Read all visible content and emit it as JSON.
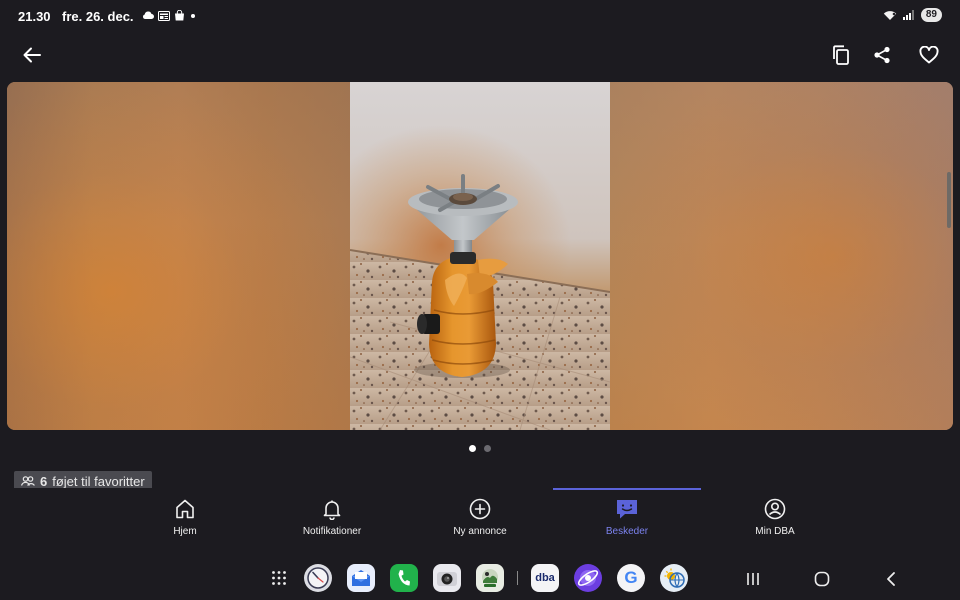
{
  "status_bar": {
    "time": "21.30",
    "date": "fre. 26. dec.",
    "battery": "89",
    "left_icons": [
      "cloud-icon",
      "news-icon",
      "bag-icon",
      "dot-icon"
    ],
    "right_icons": [
      "wifi-icon",
      "signal-icon"
    ]
  },
  "app_bar": {
    "back_icon": "arrow-left-icon",
    "actions": [
      "copy-icon",
      "share-icon",
      "heart-icon"
    ]
  },
  "gallery": {
    "page_count": 2,
    "current_page": 1
  },
  "favorites": {
    "count": "6",
    "label": "føjet til favoritter"
  },
  "bottom_nav": {
    "items": [
      {
        "label": "Hjem",
        "icon": "home-icon"
      },
      {
        "label": "Notifikationer",
        "icon": "bell-icon"
      },
      {
        "label": "Ny annonce",
        "icon": "plus-circle-icon"
      },
      {
        "label": "Beskeder",
        "icon": "chat-icon"
      },
      {
        "label": "Min DBA",
        "icon": "profile-icon"
      }
    ],
    "active": "Beskeder"
  },
  "dock": {
    "apps": [
      "app-drawer-icon",
      "clock-app-icon",
      "mail-app-icon",
      "phone-app-icon",
      "camera-app-icon",
      "gallery-app-icon",
      "dba-app-icon",
      "browser-app-icon",
      "google-app-icon",
      "weather-app-icon"
    ],
    "dba_label": "dba",
    "google_label": "G"
  },
  "colors": {
    "background": "#1c1b20",
    "accent": "#5b63d8",
    "active_label": "#7b82ee"
  }
}
